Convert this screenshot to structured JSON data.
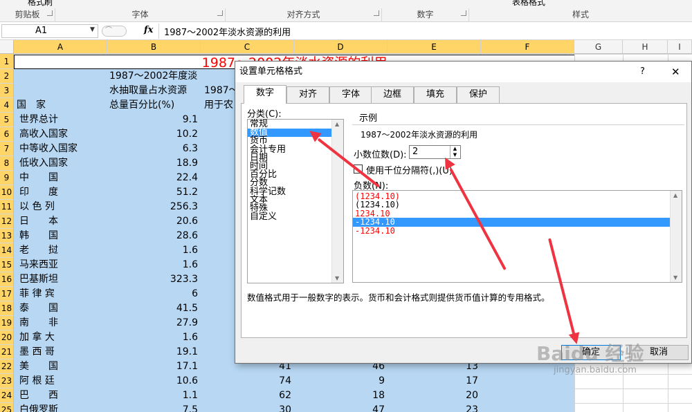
{
  "ribbon": {
    "groups": [
      "剪贴板",
      "字体",
      "对齐方式",
      "数字",
      "样式"
    ],
    "top_partial": [
      "格式刷",
      "表格格式"
    ]
  },
  "formula_bar": {
    "name_box": "A1",
    "fx": "fx",
    "content": "1987～2002年淡水资源的利用"
  },
  "columns": [
    "A",
    "B",
    "C",
    "D",
    "E",
    "F",
    "G",
    "H",
    "I"
  ],
  "rows": [
    "1",
    "2",
    "3",
    "4",
    "5",
    "6",
    "7",
    "8",
    "9",
    "10",
    "11",
    "12",
    "13",
    "14",
    "15",
    "16",
    "17",
    "18",
    "19",
    "20",
    "21",
    "22",
    "23",
    "24",
    "25"
  ],
  "sheet": {
    "title": "1987～2002年淡水资源的利用",
    "header_b": [
      "1987～2002年度淡",
      "水抽取量占水资源",
      "总量百分比(%)"
    ],
    "header_c": [
      "1987～",
      "用于农"
    ],
    "header_a": "国　家",
    "countries": [
      "世界总计",
      "高收入国家",
      "中等收入国家",
      "低收入国家",
      "中　　国",
      "印　　度",
      "以 色 列",
      "日　　本",
      "韩　　国",
      "老　　挝",
      "马来西亚",
      "巴基斯坦",
      "菲 律 宾",
      "泰　　国",
      "南　　非",
      "加 拿 大",
      "墨 西 哥",
      "美　　国",
      "阿 根 廷",
      "巴　　西",
      "白俄罗斯"
    ],
    "values_b": [
      "9.1",
      "10.2",
      "6.3",
      "18.9",
      "22.4",
      "51.2",
      "256.3",
      "20.6",
      "28.6",
      "1.6",
      "1.6",
      "323.3",
      "6",
      "41.5",
      "27.9",
      "1.6",
      "19.1",
      "17.1",
      "10.6",
      "1.1",
      "7.5"
    ],
    "values_c_tail": [
      "41",
      "74",
      "62",
      "30"
    ],
    "values_d_tail": [
      "46",
      "9",
      "18",
      "47"
    ],
    "values_e_tail": [
      "13",
      "17",
      "20",
      "23"
    ]
  },
  "dialog": {
    "title": "设置单元格格式",
    "help": "?",
    "close": "✕",
    "tabs": [
      "数字",
      "对齐",
      "字体",
      "边框",
      "填充",
      "保护"
    ],
    "category_label": "分类(C):",
    "categories": [
      "常规",
      "数值",
      "货币",
      "会计专用",
      "日期",
      "时间",
      "百分比",
      "分数",
      "科学记数",
      "文本",
      "特殊",
      "自定义"
    ],
    "selected_category": "数值",
    "sample_label": "示例",
    "sample_value": "1987～2002年淡水资源的利用",
    "decimal_label": "小数位数(D):",
    "decimal_value": "2",
    "thousands_label": "使用千位分隔符(,)(U)",
    "negative_label": "负数(N):",
    "negatives": [
      "(1234.10)",
      "(1234.10)",
      "1234.10",
      "-1234.10",
      "-1234.10"
    ],
    "description": "数值格式用于一般数字的表示。货币和会计格式则提供货币值计算的专用格式。",
    "ok": "确定",
    "cancel": "取消"
  },
  "colors": {
    "accent": "#3399ff",
    "selection": "#b7d7f3",
    "header_selected": "#ffd567",
    "title_red": "#ff0000",
    "arrow_red": "#ef3340"
  },
  "watermark": [
    "Baidu 经验",
    "jingyan.baidu.com"
  ]
}
